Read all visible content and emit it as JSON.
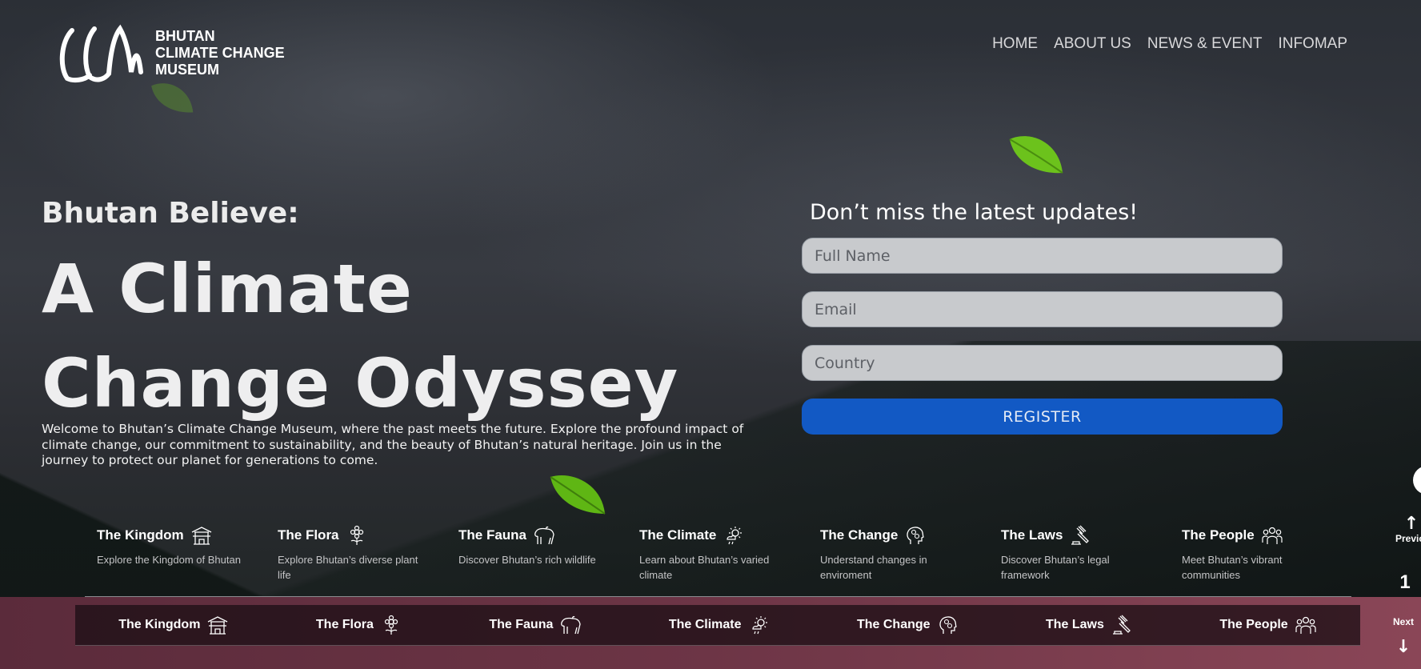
{
  "header": {
    "logo_lines": [
      "BHUTAN",
      "CLIMATE CHANGE",
      "MUSEUM"
    ],
    "logo_mark_text": "CCM",
    "nav": [
      "HOME",
      "ABOUT US",
      "NEWS & EVENT",
      "INFOMAP"
    ]
  },
  "hero": {
    "eyebrow": "Bhutan Believe:",
    "headline_line1": "A Climate",
    "headline_line2": "Change Odyssey",
    "intro": "Welcome to Bhutan’s Climate Change Museum, where the past meets the future. Explore the profound impact of climate change, our commitment to sustainability, and the beauty of Bhutan’s natural heritage. Join us in the journey to protect our planet for generations to come."
  },
  "signup": {
    "title": "Don’t miss the latest updates!",
    "full_name_placeholder": "Full Name",
    "email_placeholder": "Email",
    "country_placeholder": "Country",
    "register_label": "REGISTER"
  },
  "categories": [
    {
      "title": "The Kingdom",
      "desc": "Explore the Kingdom of Bhutan",
      "icon": "dzong-icon"
    },
    {
      "title": "The Flora",
      "desc": "Explore Bhutan’s diverse plant life",
      "icon": "flower-icon"
    },
    {
      "title": "The Fauna",
      "desc": "Discover Bhutan’s rich wildlife",
      "icon": "takin-icon"
    },
    {
      "title": "The Climate",
      "desc": "Learn about Bhutan’s varied climate",
      "icon": "weather-icon"
    },
    {
      "title": "The Change",
      "desc": "Understand changes in enviroment",
      "icon": "head-gears-icon"
    },
    {
      "title": "The Laws",
      "desc": "Discover Bhutan’s legal framework",
      "icon": "gavel-icon"
    },
    {
      "title": "The People",
      "desc": "Meet Bhutan’s vibrant communities",
      "icon": "people-icon"
    }
  ],
  "side_nav": {
    "previous_label": "Previous",
    "current_number": "1",
    "next_label": "Next"
  },
  "colors": {
    "register_button": "#1259c4",
    "bottom_band": "#6d3546",
    "leaf": "#6cc21c"
  }
}
